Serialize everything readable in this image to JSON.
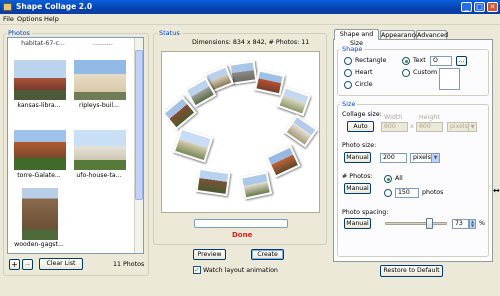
{
  "window": {
    "title": "Shape Collage 2.0",
    "min": "_",
    "max": "□",
    "close": "✕"
  },
  "menu": [
    "File",
    "Options",
    "Help"
  ],
  "photos": {
    "label": "Photos",
    "items": [
      "habitat-67-c...",
      "kansas-libra...",
      "ripleys-buil...",
      "torre-Galate...",
      "ufo-house-ta...",
      "wooden-gagst..."
    ],
    "add_label": "+",
    "remove_label": "−",
    "clear_label": "Clear List",
    "count_text": "11 Photos"
  },
  "status": {
    "label": "Status",
    "dimensions_text": "Dimensions: 834 x 842, # Photos: 11",
    "progress": 0,
    "done_text": "Done",
    "done_color": "#e0201c",
    "preview_label": "Preview",
    "create_label": "Create",
    "watch_label": "Watch layout animation",
    "watch_checked": true
  },
  "tabs": [
    "Shape and Size",
    "Appearance",
    "Advanced"
  ],
  "shape": {
    "label": "Shape",
    "options": [
      "Rectangle",
      "Heart",
      "Circle",
      "Text",
      "Custom"
    ],
    "selected": "Text",
    "text_value": "O",
    "browse_label": "..."
  },
  "size": {
    "label": "Size",
    "collage_size_label": "Collage size:",
    "collage_mode": "Auto",
    "width_label": "Width",
    "height_label": "Height",
    "width_value": "600",
    "height_value": "600",
    "unit": "pixels",
    "photo_size_label": "Photo size:",
    "photo_mode": "Manual",
    "photo_size_value": "200",
    "photo_unit": "pixels",
    "num_photos_label": "# Photos:",
    "num_mode": "Manual",
    "all_label": "All",
    "num_value": "150",
    "photos_unit": "photos",
    "spacing_label": "Photo spacing:",
    "spacing_mode": "Manual",
    "spacing_value": "73",
    "spacing_unit": "%",
    "spacing_fraction": 0.73
  },
  "restore_label": "Restore to Default",
  "colors": {
    "accent": "#0046d5",
    "title_bar": "#0842b0"
  }
}
